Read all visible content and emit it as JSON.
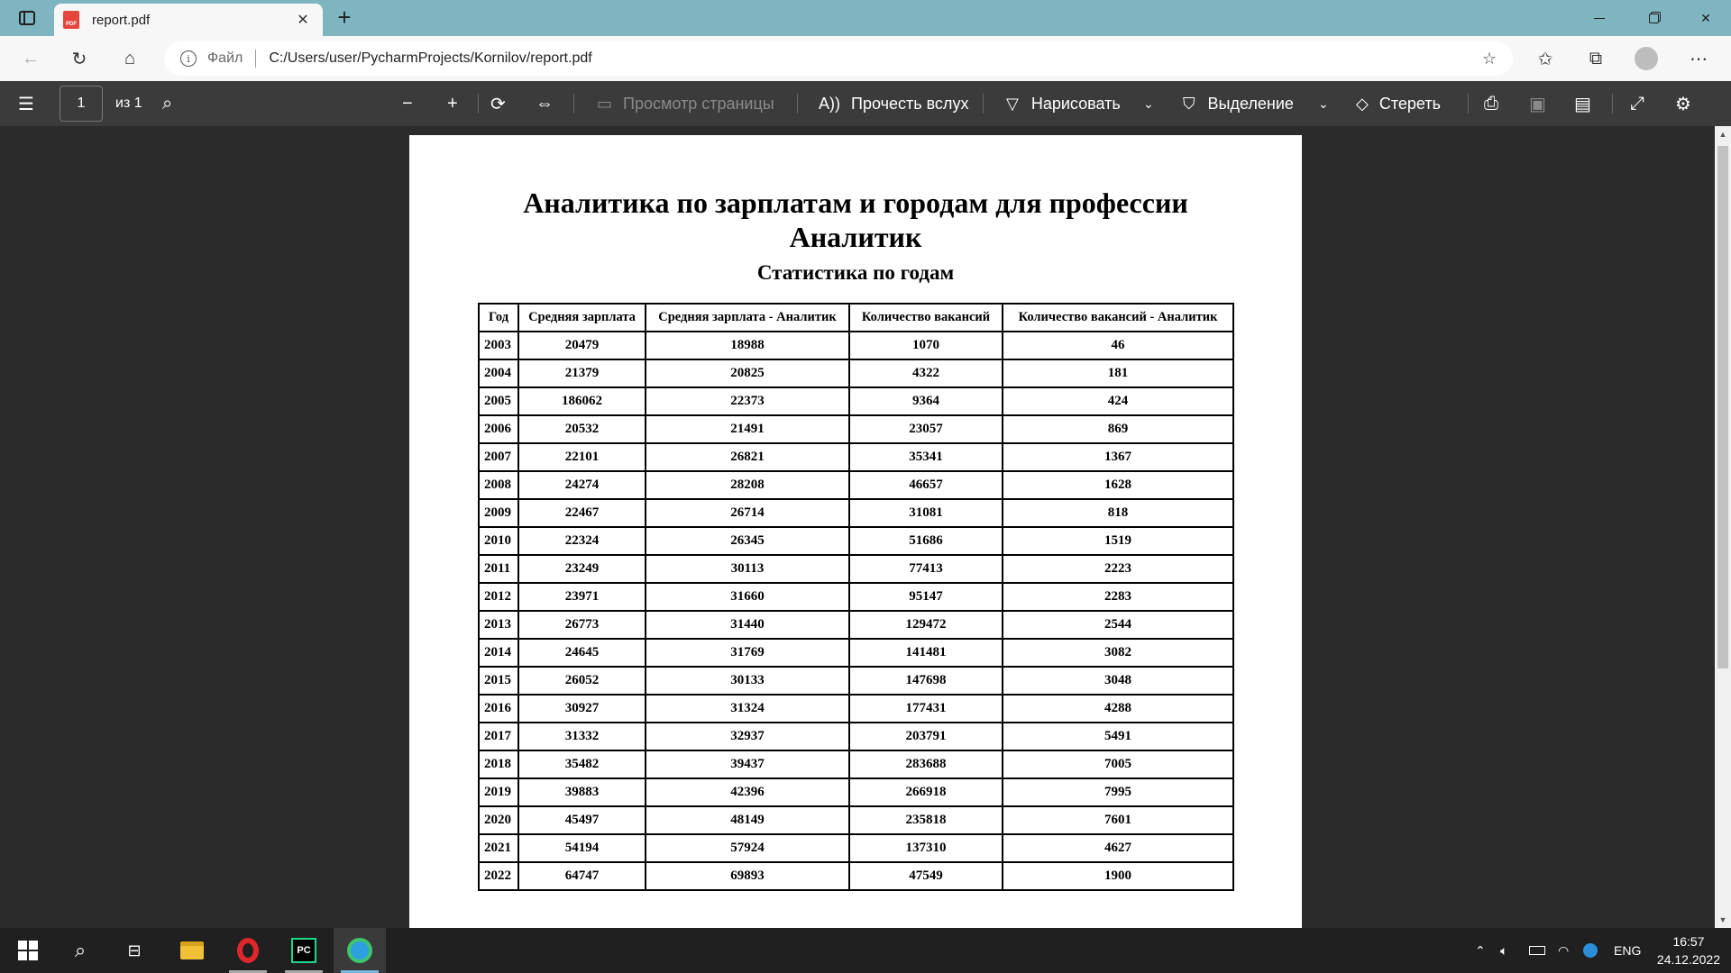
{
  "browser": {
    "tab_title": "report.pdf",
    "tab_icon_text": "PDF",
    "address_scheme": "Файл",
    "address_url": "C:/Users/user/PycharmProjects/Kornilov/report.pdf"
  },
  "pdf_toolbar": {
    "page_number": "1",
    "page_total": "из 1",
    "page_view_label": "Просмотр страницы",
    "read_aloud_label": "Прочесть вслух",
    "draw_label": "Нарисовать",
    "highlight_label": "Выделение",
    "erase_label": "Стереть"
  },
  "document": {
    "title_line1": "Аналитика по зарплатам и городам для профессии",
    "title_line2": "Аналитик",
    "subtitle": "Статистика по годам",
    "table": {
      "headers": [
        "Год",
        "Средняя зарплата",
        "Средняя зарплата - Аналитик",
        "Количество вакансий",
        "Количество вакансий - Аналитик"
      ],
      "rows": [
        [
          "2003",
          "20479",
          "18988",
          "1070",
          "46"
        ],
        [
          "2004",
          "21379",
          "20825",
          "4322",
          "181"
        ],
        [
          "2005",
          "186062",
          "22373",
          "9364",
          "424"
        ],
        [
          "2006",
          "20532",
          "21491",
          "23057",
          "869"
        ],
        [
          "2007",
          "22101",
          "26821",
          "35341",
          "1367"
        ],
        [
          "2008",
          "24274",
          "28208",
          "46657",
          "1628"
        ],
        [
          "2009",
          "22467",
          "26714",
          "31081",
          "818"
        ],
        [
          "2010",
          "22324",
          "26345",
          "51686",
          "1519"
        ],
        [
          "2011",
          "23249",
          "30113",
          "77413",
          "2223"
        ],
        [
          "2012",
          "23971",
          "31660",
          "95147",
          "2283"
        ],
        [
          "2013",
          "26773",
          "31440",
          "129472",
          "2544"
        ],
        [
          "2014",
          "24645",
          "31769",
          "141481",
          "3082"
        ],
        [
          "2015",
          "26052",
          "30133",
          "147698",
          "3048"
        ],
        [
          "2016",
          "30927",
          "31324",
          "177431",
          "4288"
        ],
        [
          "2017",
          "31332",
          "32937",
          "203791",
          "5491"
        ],
        [
          "2018",
          "35482",
          "39437",
          "283688",
          "7005"
        ],
        [
          "2019",
          "39883",
          "42396",
          "266918",
          "7995"
        ],
        [
          "2020",
          "45497",
          "48149",
          "235818",
          "7601"
        ],
        [
          "2021",
          "54194",
          "57924",
          "137310",
          "4627"
        ],
        [
          "2022",
          "64747",
          "69893",
          "47549",
          "1900"
        ]
      ]
    }
  },
  "taskbar": {
    "language": "ENG",
    "time": "16:57",
    "date": "24.12.2022",
    "pycharm_label": "PC"
  },
  "colors": {
    "tabbar": "#7fb4c1",
    "pdf_toolbar": "#3b3b3b",
    "viewer_bg": "#2b2b2b",
    "taskbar": "#202020"
  }
}
